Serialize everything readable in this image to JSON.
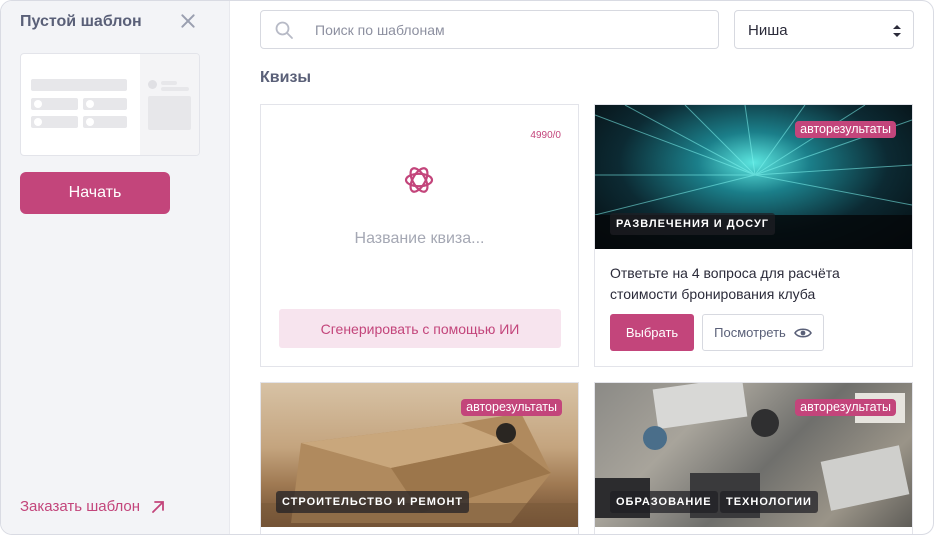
{
  "sidebar": {
    "title": "Пустой шаблон",
    "start_label": "Начать",
    "order_label": "Заказать шаблон"
  },
  "search": {
    "placeholder": "Поиск по шаблонам"
  },
  "niche_select": {
    "value": "Ниша"
  },
  "section_title": "Квизы",
  "ai_card": {
    "counter": "4990/0",
    "quiz_name_placeholder": "Название квиза...",
    "generate_label": "Сгенерировать с помощью ИИ"
  },
  "templates": [
    {
      "badge": "авторезультаты",
      "categories": [
        "РАЗВЛЕЧЕНИЯ И ДОСУГ"
      ],
      "title": "Ответьте на 4 вопроса для расчёта стоимости бронирования клуба",
      "select_label": "Выбрать",
      "view_label": "Посмотреть",
      "image": "nightclub-lasers"
    },
    {
      "badge": "авторезультаты",
      "categories": [
        "СТРОИТЕЛЬСТВО И РЕМОНТ"
      ],
      "image": "cat-in-cardboard-box"
    },
    {
      "badge": "авторезультаты",
      "categories": [
        "ОБРАЗОВАНИЕ",
        "ТЕХНОЛОГИИ"
      ],
      "image": "desk-with-laptops"
    }
  ],
  "colors": {
    "accent": "#c3457b",
    "accent_light": "#f7e4ee",
    "sidebar_bg": "#f3f4f7",
    "muted_text": "#5a6078"
  }
}
